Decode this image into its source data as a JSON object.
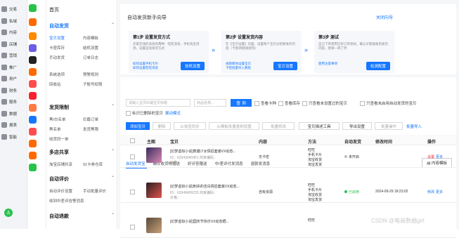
{
  "left_rail": [
    {
      "label": "交易",
      "color": "#1677ff"
    },
    {
      "label": "私域",
      "color": "#1677ff"
    },
    {
      "label": "内容",
      "color": "#1677ff"
    },
    {
      "label": "店铺",
      "color": "#1677ff"
    },
    {
      "label": "营销",
      "color": "#1677ff"
    },
    {
      "label": "推广",
      "color": "#1677ff"
    },
    {
      "label": "用户",
      "color": "#1677ff"
    },
    {
      "label": "财务",
      "color": "#1677ff"
    },
    {
      "label": "服务",
      "color": "#1677ff"
    },
    {
      "label": "数据",
      "color": "#1677ff"
    },
    {
      "label": "报表",
      "color": "#1677ff"
    },
    {
      "label": "智能",
      "color": "#1677ff"
    }
  ],
  "menu": {
    "home": "首页",
    "groups": [
      {
        "title": "自动发货",
        "active": true,
        "rows": [
          [
            "宝贝设置",
            "内容模板"
          ],
          [
            "卡密库存",
            "结机设置"
          ],
          [
            "手动发货",
            "订单日志"
          ]
        ],
        "extra": [
          [
            "系统选项",
            "预警规则"
          ],
          [
            "回收站",
            "子账号权限"
          ]
        ]
      },
      {
        "title": "发货限制",
        "rows": [
          [
            "黑/白名单",
            "拦截订单"
          ],
          [
            "黑名单",
            "发货黑限"
          ],
          [
            "收货同一单",
            ""
          ]
        ]
      },
      {
        "title": "多店共享",
        "rows": [
          [
            "淘宝店铺共享",
            "91卡券仓库"
          ]
        ]
      },
      {
        "title": "自动评价",
        "rows": [
          [
            "自动评价设置",
            "手动批量评价"
          ],
          [
            "收到中差评告警消息",
            ""
          ]
        ]
      },
      {
        "title": "自动退款",
        "rows": []
      }
    ]
  },
  "guide": {
    "title": "自动发货新手向导",
    "close_link": "关闭向导",
    "steps": [
      {
        "title": "第1步 设置发货方式",
        "desc": "买家在线的途径有两种：旺旺消息、手机淘宝消息，设置自动发货方式",
        "links": "如何设置手机卡片\n如何设置旺旺消息",
        "button": "挂机设置"
      },
      {
        "title": "第2步 设置发货内容",
        "desc": "在【宝贝设置】页面，设置每个宝贝分别要发的内容（卡密/网盘链接等）",
        "links": "视频教你设置宝贝\n卡密批量导入教程",
        "button": "宝贝设置"
      },
      {
        "title": "第3步 测试",
        "desc": "自己下单或用已有订单测试，确认买家能收到发货内容，结果一目了然",
        "links": "使用注意事项",
        "button": "检测配置"
      }
    ]
  },
  "tabs": [
    "自动发货宝",
    "确认收货物赠送",
    "好评答赠送",
    "中/差评付发消息",
    "退款发消息"
  ],
  "template_button": "内容模板",
  "search": {
    "placeholder": "请输入宝贝ID或宝贝标题",
    "secondary_placeholder": "商品名称...",
    "button": "查 询",
    "filters": [
      "查看卡种",
      "查看库存",
      "只查看未设置过的宝贝",
      "只查看未启用自动发货的宝贝"
    ],
    "filter2": "标识已删除的宝贝",
    "filter2_link": "展动模式"
  },
  "toolbar": {
    "add": "添加宝贝",
    "b1": "删除",
    "b2": "从淘宝同步",
    "b3": "从模板批量复制设置",
    "b4": "批量修改",
    "b5": "宝贝描述工具",
    "b6": "导出设置",
    "b7": "批量操作",
    "link": "批量导入"
  },
  "table": {
    "headers": [
      "主图",
      "宝贝",
      "内容",
      "方法",
      "自动发货",
      "修改时间",
      "操作"
    ],
    "rows": [
      {
        "title": "[幻梦虚拟小说]熊猫少女情侣套装VX动态...",
        "id": "ID：63343040451 商家编码：",
        "sub": "价格：",
        "content": "无卡密",
        "methods": [
          "旺旺",
          "手机卡片",
          "淘宝收货",
          "淘宝发货"
        ],
        "auto": "未开启",
        "auto_on": false,
        "time": "",
        "ops": [
          "设置",
          "更多"
        ]
      },
      {
        "title": "[幻梦虚拟小说]刺杀的吉白情侣套装VX动态...",
        "id": "ID：63349499233 商家编码：",
        "sub": "价格：",
        "content": "自有资源",
        "methods": [
          "旺旺",
          "手机卡片",
          "淘宝收货",
          "淘宝发货"
        ],
        "auto": "已启用",
        "auto_on": true,
        "time": "2024-09-29 18:23:02",
        "ops": [
          "修改",
          "更多"
        ]
      },
      {
        "title": "[幻梦虚拟小说]国庆节快乐VX动态晒...",
        "id": "",
        "sub": "",
        "content": "",
        "methods": [
          "旺旺"
        ],
        "auto": "",
        "auto_on": false,
        "time": "",
        "ops": []
      }
    ]
  },
  "watermark": "CSDN @电商数据girl"
}
